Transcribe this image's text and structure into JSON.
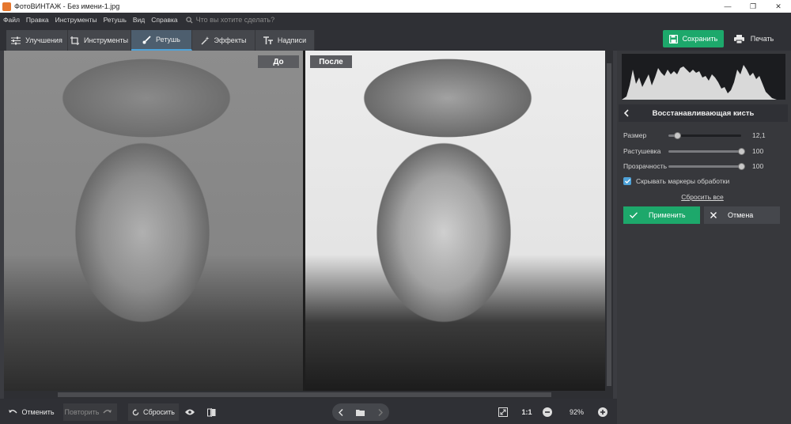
{
  "window": {
    "title": "ФотоВИНТАЖ - Без имени-1.jpg",
    "minimize": "—",
    "maximize": "❐",
    "close": "✕"
  },
  "menu": {
    "items": [
      "Файл",
      "Правка",
      "Инструменты",
      "Ретушь",
      "Вид",
      "Справка"
    ],
    "search_placeholder": "Что вы хотите сделать?"
  },
  "tabs": [
    {
      "label": "Улучшения",
      "icon": "sliders-icon"
    },
    {
      "label": "Инструменты",
      "icon": "crop-icon"
    },
    {
      "label": "Ретушь",
      "icon": "brush-icon",
      "active": true
    },
    {
      "label": "Эффекты",
      "icon": "magic-wand-icon"
    },
    {
      "label": "Надписи",
      "icon": "text-icon"
    }
  ],
  "actions": {
    "save_label": "Сохранить",
    "print_label": "Печать"
  },
  "compare": {
    "before_label": "До",
    "after_label": "После"
  },
  "bottom": {
    "undo_label": "Отменить",
    "redo_label": "Повторить",
    "reset_label": "Сбросить",
    "one_to_one": "1:1",
    "zoom": "92%"
  },
  "panel": {
    "title": "Восстанавливающая кисть",
    "sliders": [
      {
        "label": "Размер",
        "value": "12,1",
        "fraction": 0.12
      },
      {
        "label": "Растушевка",
        "value": "100",
        "fraction": 1.0
      },
      {
        "label": "Прозрачность",
        "value": "100",
        "fraction": 1.0
      }
    ],
    "hide_markers_label": "Скрывать маркеры обработки",
    "hide_markers_checked": true,
    "reset_all_label": "Сбросить все",
    "apply_label": "Применить",
    "cancel_label": "Отмена"
  },
  "colors": {
    "accent_green": "#1da86b",
    "accent_blue": "#4ea2d8",
    "background": "#3b3c41"
  }
}
